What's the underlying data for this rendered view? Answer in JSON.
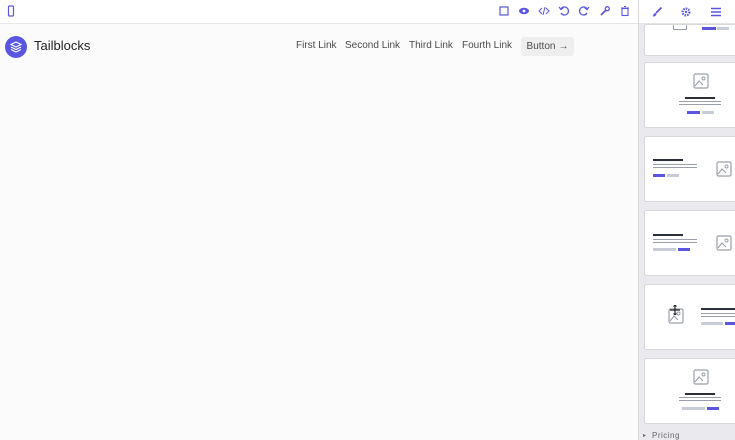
{
  "brand": {
    "name": "Tailblocks"
  },
  "nav": {
    "links": [
      "First Link",
      "Second Link",
      "Third Link",
      "Fourth Link"
    ],
    "button_label": "Button",
    "button_arrow": "→"
  },
  "sidebar": {
    "section_label": "Pricing",
    "caret": "▸"
  },
  "colors": {
    "accent": "#5a56e0",
    "dark_line": "#2b2f3a",
    "canvas": "#fbfbfb"
  }
}
